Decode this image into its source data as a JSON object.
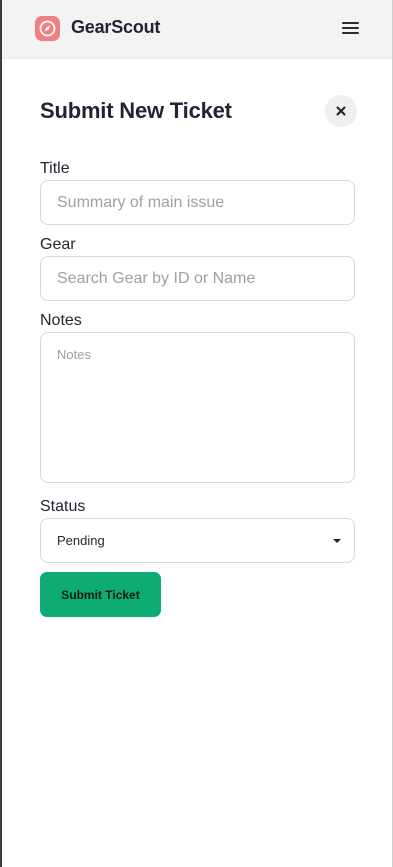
{
  "app": {
    "name": "GearScout",
    "logo_icon": "compass-icon",
    "menu_icon": "hamburger-menu-icon",
    "colors": {
      "logo": "#f07f7f",
      "submit_button": "#0eac72",
      "header_bg": "#f3f3f3"
    }
  },
  "form": {
    "heading": "Submit New Ticket",
    "close_icon": "close-icon",
    "title": {
      "label": "Title",
      "placeholder": "Summary of main issue",
      "value": ""
    },
    "gear": {
      "label": "Gear",
      "placeholder": "Search Gear by ID or Name",
      "value": ""
    },
    "notes": {
      "label": "Notes",
      "placeholder": "Notes",
      "value": ""
    },
    "status": {
      "label": "Status",
      "selected": "Pending"
    },
    "submit_label": "Submit Ticket"
  }
}
